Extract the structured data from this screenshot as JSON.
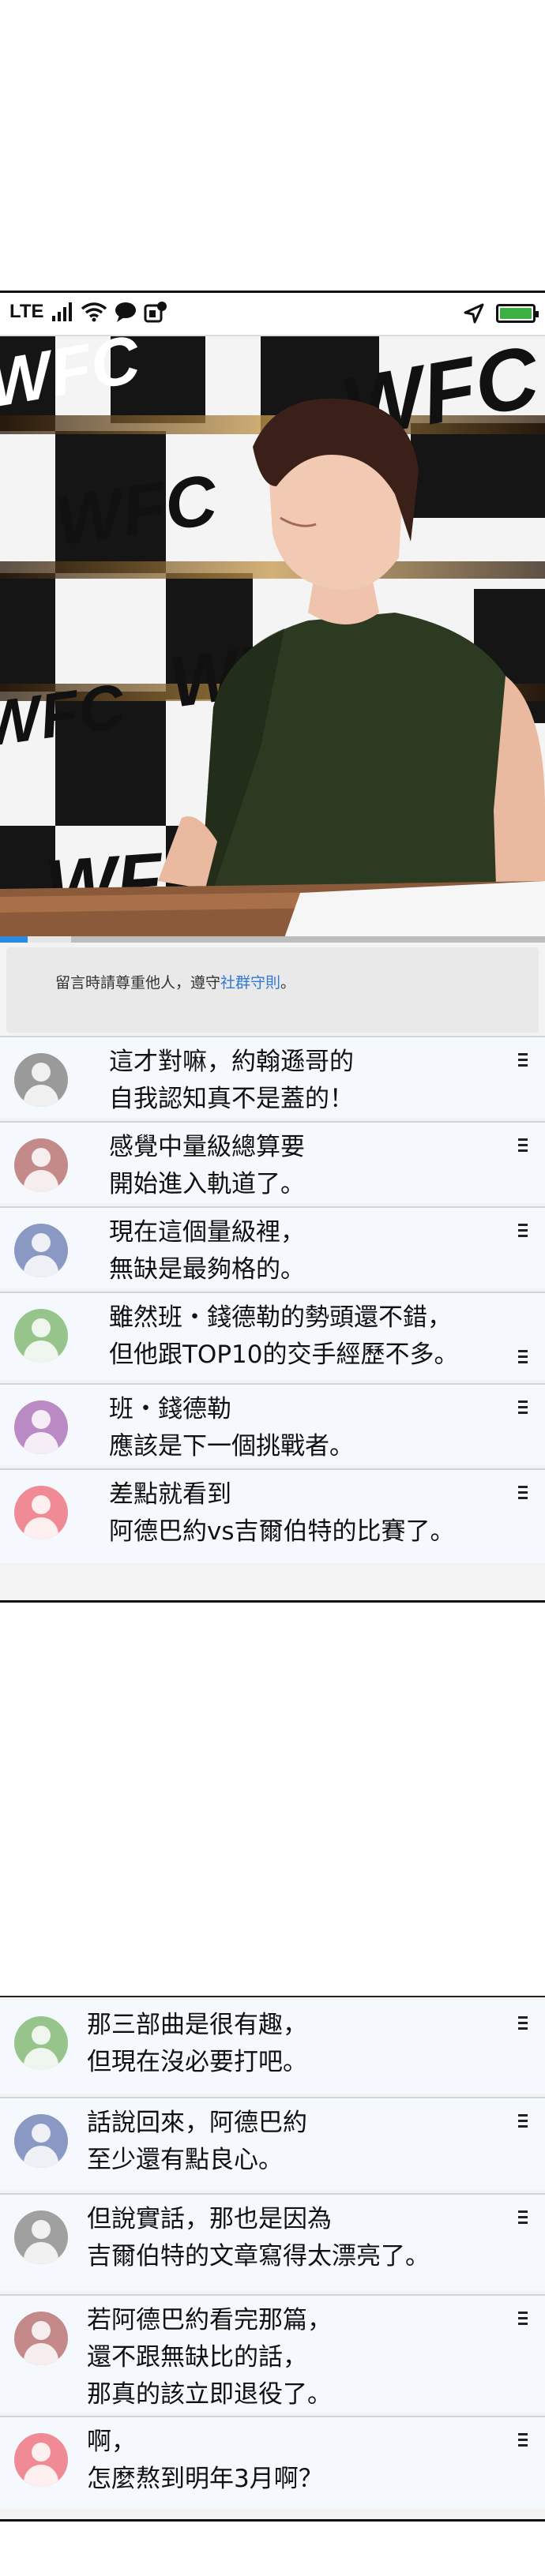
{
  "status_bar": {
    "network": "LTE"
  },
  "video": {
    "banner_text": "WFC",
    "progress_fraction": 0.05,
    "buffer_fraction": 0.13
  },
  "notice": {
    "text_before": "留言時請尊重他人，遵守",
    "link": "社群守則",
    "text_after": "。"
  },
  "comments_top": [
    {
      "text": "這才對嘛，約翰遜哥的\n自我認知真不是蓋的！",
      "avatar_color": "#9a9a9a"
    },
    {
      "text": "感覺中量級總算要\n開始進入軌道了。",
      "avatar_color": "#c48a8a"
    },
    {
      "text": "現在這個量級裡，\n無缺是最夠格的。",
      "avatar_color": "#8a99c4"
    },
    {
      "text": "雖然班・錢德勒的勢頭還不錯，\n但他跟TOP10的交手經歷不多。",
      "avatar_color": "#96c48a"
    },
    {
      "text": "班・錢德勒\n應該是下一個挑戰者。",
      "avatar_color": "#b98ac4"
    },
    {
      "text": "差點就看到\n阿德巴約vs吉爾伯特的比賽了。",
      "avatar_color": "#f08a95"
    }
  ],
  "comments_bottom": [
    {
      "text": "那三部曲是很有趣，\n但現在沒必要打吧。",
      "avatar_color": "#96c48a"
    },
    {
      "text": "話說回來，阿德巴約\n至少還有點良心。",
      "avatar_color": "#8a99c4"
    },
    {
      "text": "但說實話，那也是因為\n吉爾伯特的文章寫得太漂亮了。",
      "avatar_color": "#a0a0a0"
    },
    {
      "text": "若阿德巴約看完那篇，\n還不跟無缺比的話，\n那真的該立即退役了。",
      "avatar_color": "#c48a8a"
    },
    {
      "text": "啊，\n怎麼熬到明年3月啊？",
      "avatar_color": "#f08a95"
    }
  ],
  "colors": {
    "progress": "#2a8be0",
    "link": "#2f78d6",
    "battery": "#3cb043"
  }
}
